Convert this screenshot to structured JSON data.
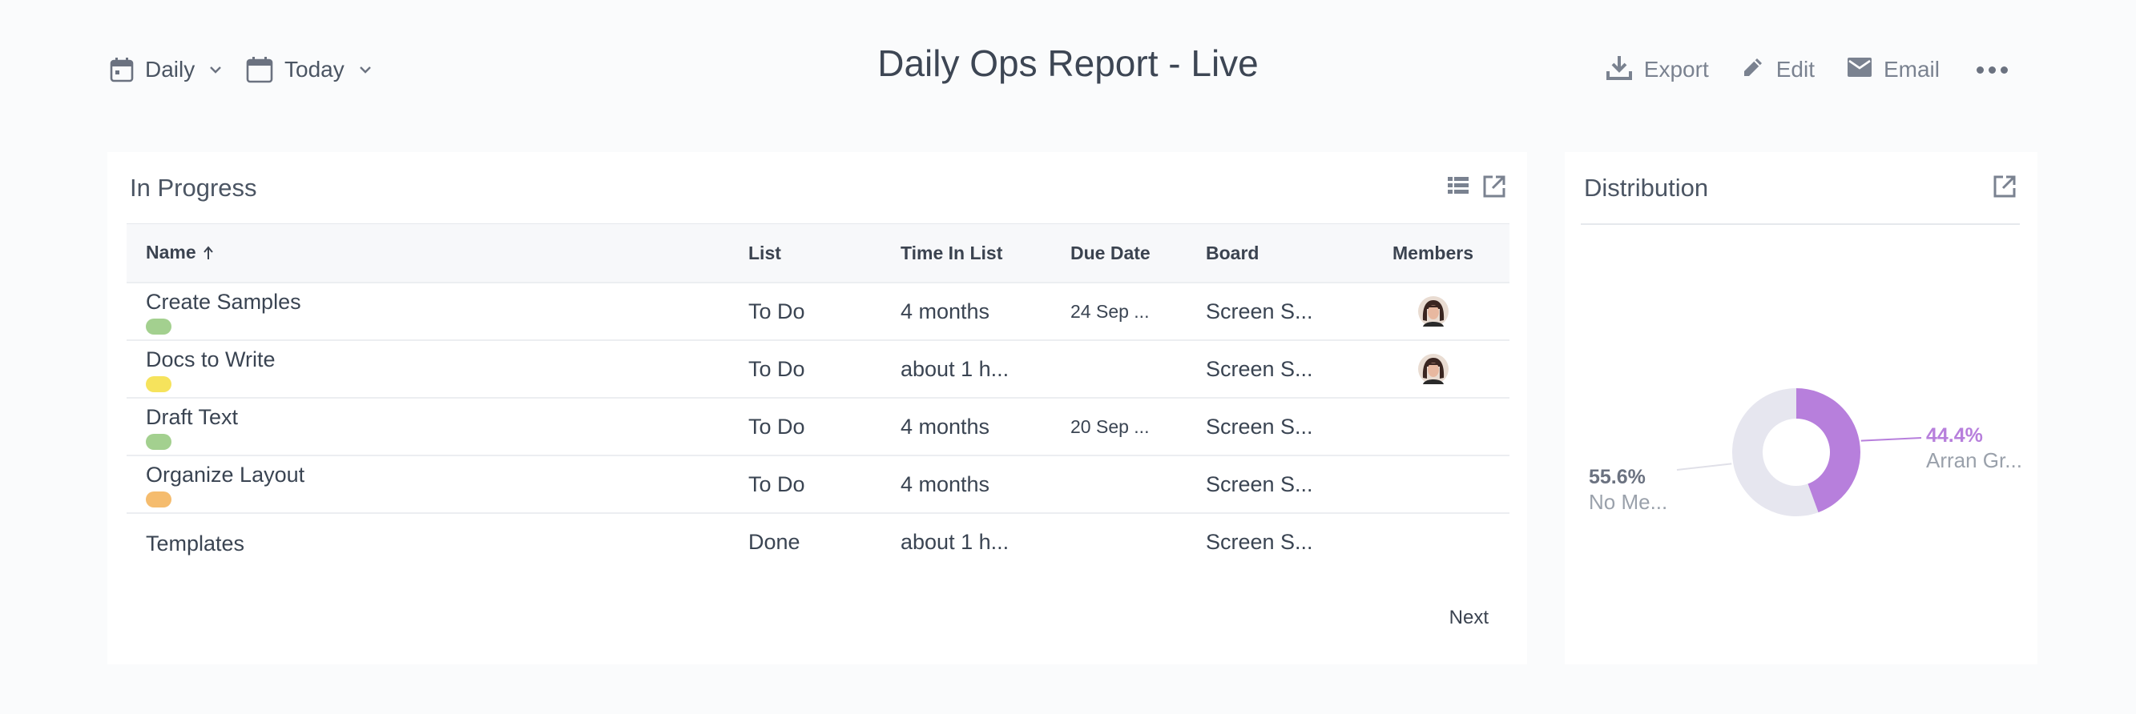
{
  "toolbar": {
    "period": "Daily",
    "date": "Today",
    "title": "Daily Ops Report - Live",
    "actions": {
      "export": "Export",
      "edit": "Edit",
      "email": "Email"
    }
  },
  "in_progress": {
    "title": "In Progress",
    "columns": {
      "name": "Name",
      "list": "List",
      "time_in_list": "Time In List",
      "due_date": "Due Date",
      "board": "Board",
      "members": "Members"
    },
    "rows": [
      {
        "name": "Create Samples",
        "label_color": "#a3d08f",
        "list": "To Do",
        "time": "4 months",
        "due": "24 Sep ...",
        "board": "Screen S...",
        "member": true
      },
      {
        "name": "Docs to Write",
        "label_color": "#f6e35c",
        "list": "To Do",
        "time": "about 1 h...",
        "due": "",
        "board": "Screen S...",
        "member": true
      },
      {
        "name": "Draft Text",
        "label_color": "#a3d08f",
        "list": "To Do",
        "time": "4 months",
        "due": "20 Sep ...",
        "board": "Screen S...",
        "member": false
      },
      {
        "name": "Organize Layout",
        "label_color": "#f5bc6e",
        "list": "To Do",
        "time": "4 months",
        "due": "",
        "board": "Screen S...",
        "member": false
      },
      {
        "name": "Templates",
        "label_color": "",
        "list": "Done",
        "time": "about 1 h...",
        "due": "",
        "board": "Screen S...",
        "member": false
      }
    ],
    "pagination": {
      "next": "Next"
    }
  },
  "distribution": {
    "title": "Distribution",
    "chart_data": {
      "type": "pie",
      "slices": [
        {
          "label": "No Me...",
          "value": 55.6,
          "display": "55.6%",
          "color": "#e6e6ef"
        },
        {
          "label": "Arran Gr...",
          "value": 44.4,
          "display": "44.4%",
          "color": "#b77fdc"
        }
      ]
    }
  },
  "colors": {
    "accent_purple": "#b77fdc",
    "muted_slice": "#e6e6ef",
    "text_dark": "#3a4452",
    "text_muted": "#7a8290"
  }
}
